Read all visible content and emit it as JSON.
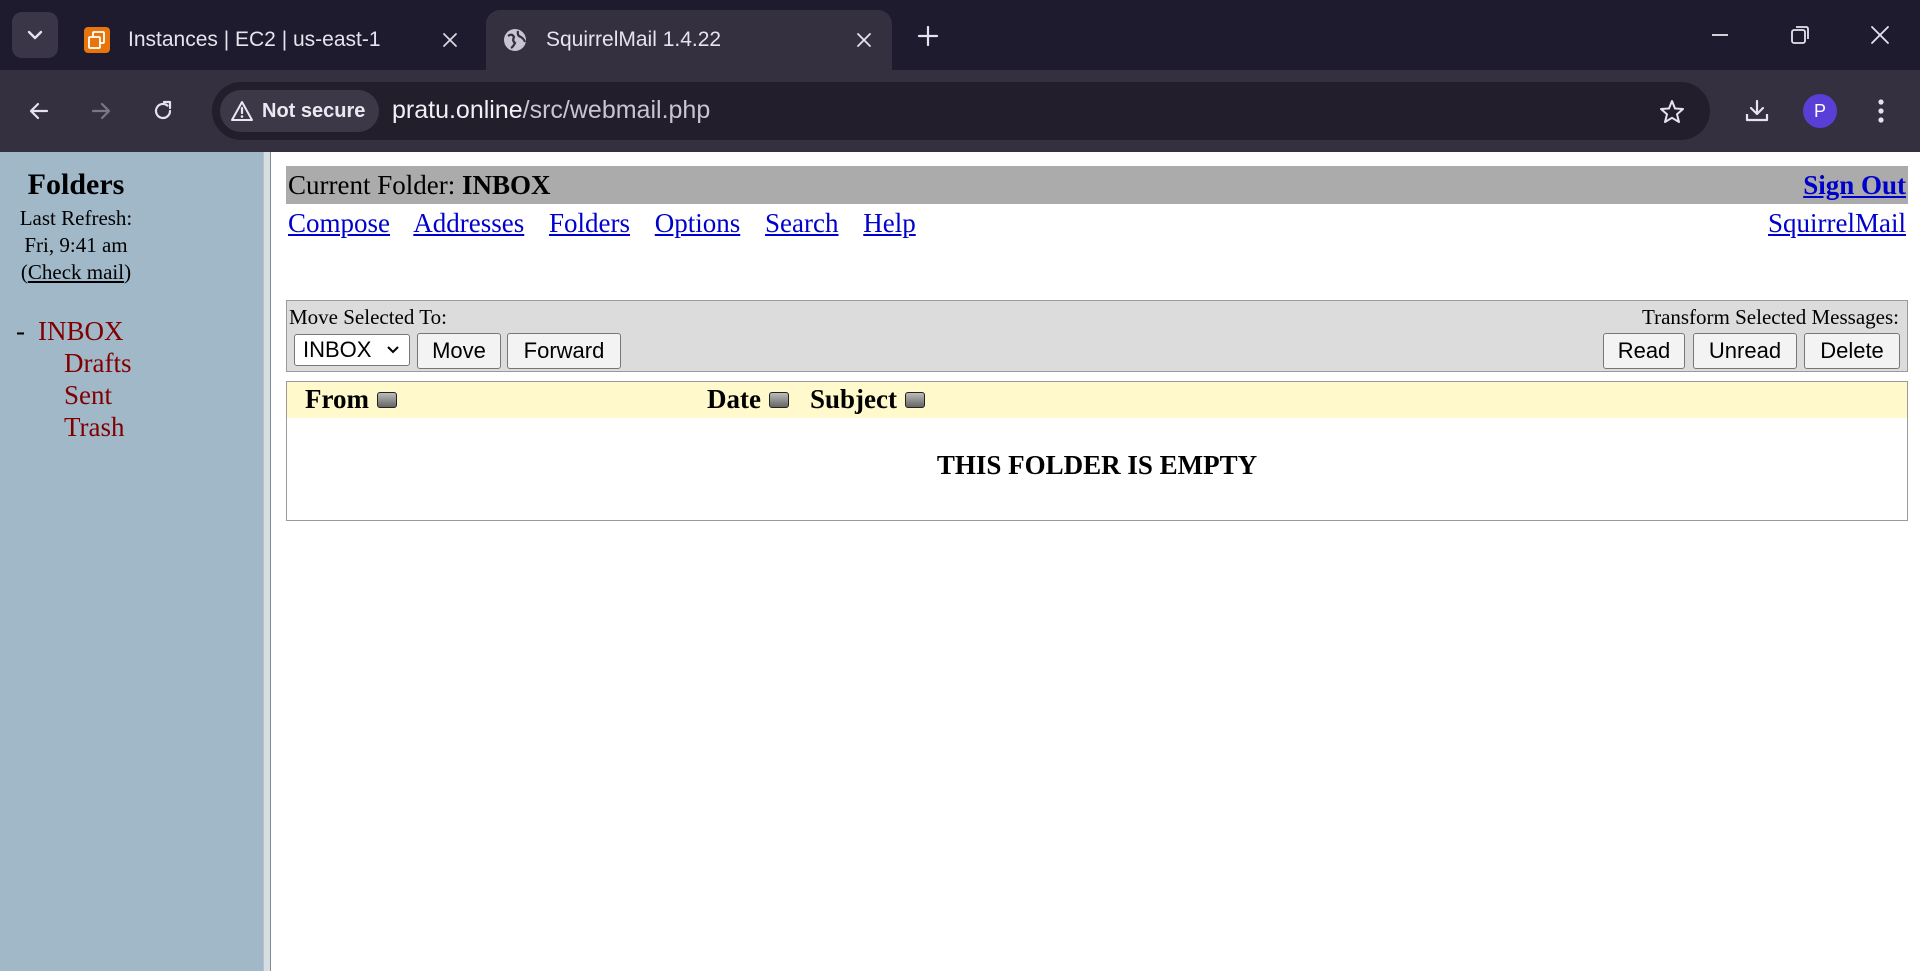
{
  "browser": {
    "tabs": [
      {
        "title": "Instances | EC2 | us-east-1",
        "active": false,
        "favicon": "aws-ec2-icon"
      },
      {
        "title": "SquirrelMail 1.4.22",
        "active": true,
        "favicon": "globe-icon"
      }
    ],
    "security_label": "Not secure",
    "url_host": "pratu.online",
    "url_path": "/src/webmail.php",
    "profile_initial": "P",
    "colors": {
      "tabbar": "#1f1b2e",
      "toolbar": "#35303f",
      "avatar": "#5a3fd6"
    }
  },
  "sidebar": {
    "title": "Folders",
    "last_refresh_label": "Last Refresh:",
    "last_refresh_time": "Fri, 9:41 am",
    "check_mail_open": "(",
    "check_mail": "Check mail",
    "check_mail_close": ")",
    "inbox_prefix": "-",
    "folders": [
      "INBOX",
      "Drafts",
      "Sent",
      "Trash"
    ],
    "colors": {
      "background": "#a1b8c9",
      "folder_text": "#800000"
    }
  },
  "header": {
    "current_folder_label": "Current Folder:",
    "current_folder": "INBOX",
    "sign_out": "Sign Out",
    "menu": [
      "Compose",
      "Addresses",
      "Folders",
      "Options",
      "Search",
      "Help"
    ],
    "brand_link": "SquirrelMail"
  },
  "actions": {
    "move_label": "Move Selected To:",
    "move_target": "INBOX",
    "move_button": "Move",
    "forward_button": "Forward",
    "transform_label": "Transform Selected Messages:",
    "read_button": "Read",
    "unread_button": "Unread",
    "delete_button": "Delete"
  },
  "message_list": {
    "columns": [
      "From",
      "Date",
      "Subject"
    ],
    "empty_text": "THIS FOLDER IS EMPTY",
    "colors": {
      "header_bg": "#fff9cc"
    }
  }
}
